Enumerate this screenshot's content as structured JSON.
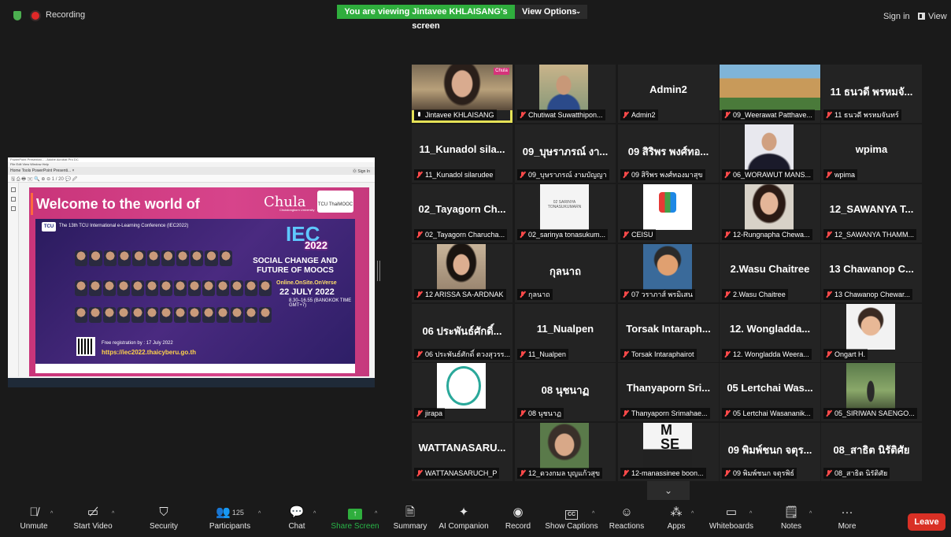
{
  "top_bar": {
    "recording_label": "Recording",
    "viewing_banner": "You are viewing Jintavee KHLAISANG's screen",
    "view_options_label": "View Options",
    "sign_in_label": "Sign in",
    "view_label": "View"
  },
  "shared_screen": {
    "window_title": "PowerPoint Presentati... - Adobe Acrobat Pro DC",
    "menu": "File  Edit  View  Window  Help",
    "tabs": "Home   Tools     PowerPoint Presenti... ×",
    "sign_in": "⓪  Sign In",
    "toolbar": "🖫 ⎙ 🖶 ✉ 🔍   ⊕ ⊖  1 / 20   💬 🖉",
    "slide": {
      "welcome": "Welcome to the world of Metaverse!",
      "chula": "Chula",
      "chula_sub": "Chulalongkorn University",
      "tu_logo": "TCU ThaiMOOC",
      "tcu": "TCU",
      "conference": "The 13th TCU International e-Learning Conference (IEC2022)",
      "iec": "IEC",
      "iec_year": "2022",
      "theme": "SOCIAL CHANGE AND FUTURE OF MOOCS",
      "modes": "Online.OnSite.OnVerse",
      "date": "22 JULY 2022",
      "time": "8.30–16.55 (BANGKOK TIME GMT+7)",
      "registration": "Free registration by : 17 July 2022",
      "url": "https://iec2022.thaicyberu.go.th"
    }
  },
  "participants": [
    {
      "big": "",
      "label": "Jintavee KHLAISANG",
      "muted": false,
      "photo": "woman",
      "active": true
    },
    {
      "big": "",
      "label": "Chutiwat Suwatthipon...",
      "muted": true,
      "photo": "man"
    },
    {
      "big": "Admin2",
      "label": "Admin2",
      "muted": true
    },
    {
      "big": "",
      "label": "09_Weerawat Patthave...",
      "muted": true,
      "photo": "building"
    },
    {
      "big": "11 ธนวดี พรหมจั...",
      "label": "11 ธนวดี พรหมจันทร์",
      "muted": true
    },
    {
      "big": "11_Kunadol sila...",
      "label": "11_Kunadol silarudee",
      "muted": true
    },
    {
      "big": "09_บุษราภรณ์ งา...",
      "label": "09_บุษราภรณ์ งามบัญญา",
      "muted": true
    },
    {
      "big": "09 สิริพร พงศ์ทอ...",
      "label": "09 สิริพร พงศ์ทองมาสุข",
      "muted": true
    },
    {
      "big": "",
      "label": "06_WORAWUT MANS...",
      "muted": true,
      "photo": "suit"
    },
    {
      "big": "wpima",
      "label": "wpima",
      "muted": true
    },
    {
      "big": "02_Tayagorn Ch...",
      "label": "02_Tayagorn Charucha...",
      "muted": true
    },
    {
      "big": "",
      "label": "02_sarinya tonasukum...",
      "muted": true,
      "photo": "cert",
      "photo_text": "02 SARINYA TONASUKUMARN"
    },
    {
      "big": "",
      "label": "CEISU",
      "muted": true,
      "photo": "edu"
    },
    {
      "big": "",
      "label": "12-Rungnapha Chewa...",
      "muted": true,
      "photo": "woman2"
    },
    {
      "big": "12_SAWANYA T...",
      "label": "12_SAWANYA THAMM...",
      "muted": true
    },
    {
      "big": "",
      "label": "12 ARISSA SA-ARDNAK",
      "muted": true,
      "photo": "woman3"
    },
    {
      "big": "กุลนาถ",
      "label": "กุลนาถ",
      "muted": true
    },
    {
      "big": "",
      "label": "07 วราภาส์ พรมิเสน",
      "muted": true,
      "photo": "avatar"
    },
    {
      "big": "2.Wasu Chaitree",
      "label": "2.Wasu Chaitree",
      "muted": true
    },
    {
      "big": "13 Chawanop C...",
      "label": "13 Chawanop Chewar...",
      "muted": true
    },
    {
      "big": "06 ประพันธ์ศักดิ์...",
      "label": "06 ประพันธ์ศักดิ์ ตวงสุวรร...",
      "muted": true
    },
    {
      "big": "11_Nualpen",
      "label": "11_Nualpen",
      "muted": true
    },
    {
      "big": "Torsak Intaraph...",
      "label": "Torsak Intaraphairot",
      "muted": true
    },
    {
      "big": "12. Wongladda...",
      "label": "12. Wongladda Weera...",
      "muted": true
    },
    {
      "big": "",
      "label": "Ongart H.",
      "muted": true,
      "photo": "avatar2"
    },
    {
      "big": "",
      "label": "jirapa",
      "muted": true,
      "photo": "logo"
    },
    {
      "big": "08 นุชนาฏ",
      "label": "08 นุชนาฏ",
      "muted": true
    },
    {
      "big": "Thanyaporn Sri...",
      "label": "Thanyaporn Srimahae...",
      "muted": true
    },
    {
      "big": "05 Lertchai Was...",
      "label": "05 Lertchai Wasananik...",
      "muted": true
    },
    {
      "big": "",
      "label": "05_SIRIWAN SAENGO...",
      "muted": true,
      "photo": "outdoor"
    },
    {
      "big": "WATTANASARU...",
      "label": "WATTANASARUCH_P",
      "muted": true
    },
    {
      "big": "",
      "label": "12_ดวงกมล บุญแก้วสุข",
      "muted": true,
      "photo": "oldwoman"
    },
    {
      "big": "",
      "label": "12-manassinee boon...",
      "muted": true,
      "photo": "stage"
    },
    {
      "big": "09 พิมพ์ชนก จตุร...",
      "label": "09 พิมพ์ชนก จตุรพิธ์",
      "muted": true
    },
    {
      "big": "08_สาธิต นิรัติศัย",
      "label": "08_สาธิต นิรัติศัย",
      "muted": true
    }
  ],
  "controls": {
    "unmute": "Unmute",
    "start_video": "Start Video",
    "security": "Security",
    "participants": "Participants",
    "participants_count": "125",
    "chat": "Chat",
    "share_screen": "Share Screen",
    "summary": "Summary",
    "ai_companion": "AI Companion",
    "record": "Record",
    "show_captions": "Show Captions",
    "reactions": "Reactions",
    "apps": "Apps",
    "whiteboards": "Whiteboards",
    "notes": "Notes",
    "more": "More",
    "leave": "Leave"
  },
  "colors": {
    "accent_green": "#2fae3d",
    "leave_red": "#d93025",
    "active_speaker": "#e6e257",
    "muted_red": "#ff4a4a"
  }
}
